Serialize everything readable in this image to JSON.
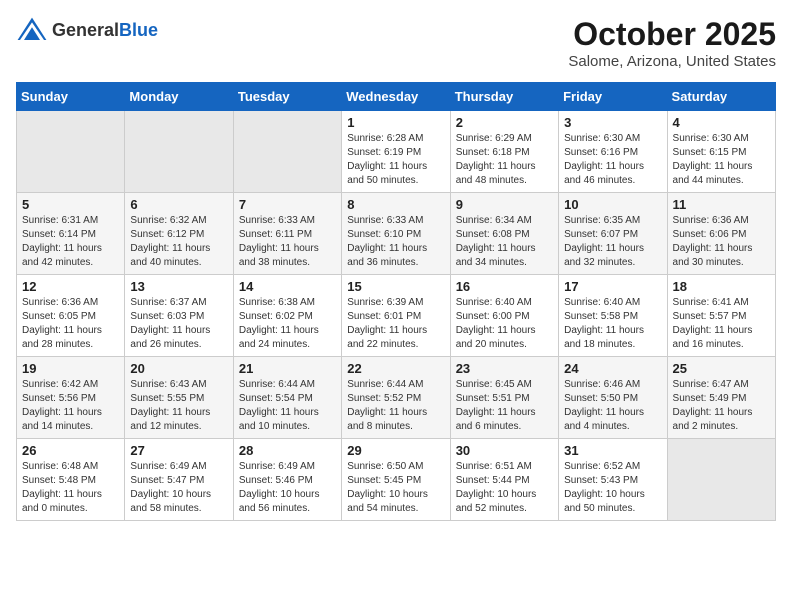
{
  "header": {
    "logo_general": "General",
    "logo_blue": "Blue",
    "month": "October 2025",
    "location": "Salome, Arizona, United States"
  },
  "weekdays": [
    "Sunday",
    "Monday",
    "Tuesday",
    "Wednesday",
    "Thursday",
    "Friday",
    "Saturday"
  ],
  "weeks": [
    [
      {
        "day": "",
        "empty": true
      },
      {
        "day": "",
        "empty": true
      },
      {
        "day": "",
        "empty": true
      },
      {
        "day": "1",
        "sunrise": "6:28 AM",
        "sunset": "6:19 PM",
        "daylight": "11 hours and 50 minutes."
      },
      {
        "day": "2",
        "sunrise": "6:29 AM",
        "sunset": "6:18 PM",
        "daylight": "11 hours and 48 minutes."
      },
      {
        "day": "3",
        "sunrise": "6:30 AM",
        "sunset": "6:16 PM",
        "daylight": "11 hours and 46 minutes."
      },
      {
        "day": "4",
        "sunrise": "6:30 AM",
        "sunset": "6:15 PM",
        "daylight": "11 hours and 44 minutes."
      }
    ],
    [
      {
        "day": "5",
        "sunrise": "6:31 AM",
        "sunset": "6:14 PM",
        "daylight": "11 hours and 42 minutes."
      },
      {
        "day": "6",
        "sunrise": "6:32 AM",
        "sunset": "6:12 PM",
        "daylight": "11 hours and 40 minutes."
      },
      {
        "day": "7",
        "sunrise": "6:33 AM",
        "sunset": "6:11 PM",
        "daylight": "11 hours and 38 minutes."
      },
      {
        "day": "8",
        "sunrise": "6:33 AM",
        "sunset": "6:10 PM",
        "daylight": "11 hours and 36 minutes."
      },
      {
        "day": "9",
        "sunrise": "6:34 AM",
        "sunset": "6:08 PM",
        "daylight": "11 hours and 34 minutes."
      },
      {
        "day": "10",
        "sunrise": "6:35 AM",
        "sunset": "6:07 PM",
        "daylight": "11 hours and 32 minutes."
      },
      {
        "day": "11",
        "sunrise": "6:36 AM",
        "sunset": "6:06 PM",
        "daylight": "11 hours and 30 minutes."
      }
    ],
    [
      {
        "day": "12",
        "sunrise": "6:36 AM",
        "sunset": "6:05 PM",
        "daylight": "11 hours and 28 minutes."
      },
      {
        "day": "13",
        "sunrise": "6:37 AM",
        "sunset": "6:03 PM",
        "daylight": "11 hours and 26 minutes."
      },
      {
        "day": "14",
        "sunrise": "6:38 AM",
        "sunset": "6:02 PM",
        "daylight": "11 hours and 24 minutes."
      },
      {
        "day": "15",
        "sunrise": "6:39 AM",
        "sunset": "6:01 PM",
        "daylight": "11 hours and 22 minutes."
      },
      {
        "day": "16",
        "sunrise": "6:40 AM",
        "sunset": "6:00 PM",
        "daylight": "11 hours and 20 minutes."
      },
      {
        "day": "17",
        "sunrise": "6:40 AM",
        "sunset": "5:58 PM",
        "daylight": "11 hours and 18 minutes."
      },
      {
        "day": "18",
        "sunrise": "6:41 AM",
        "sunset": "5:57 PM",
        "daylight": "11 hours and 16 minutes."
      }
    ],
    [
      {
        "day": "19",
        "sunrise": "6:42 AM",
        "sunset": "5:56 PM",
        "daylight": "11 hours and 14 minutes."
      },
      {
        "day": "20",
        "sunrise": "6:43 AM",
        "sunset": "5:55 PM",
        "daylight": "11 hours and 12 minutes."
      },
      {
        "day": "21",
        "sunrise": "6:44 AM",
        "sunset": "5:54 PM",
        "daylight": "11 hours and 10 minutes."
      },
      {
        "day": "22",
        "sunrise": "6:44 AM",
        "sunset": "5:52 PM",
        "daylight": "11 hours and 8 minutes."
      },
      {
        "day": "23",
        "sunrise": "6:45 AM",
        "sunset": "5:51 PM",
        "daylight": "11 hours and 6 minutes."
      },
      {
        "day": "24",
        "sunrise": "6:46 AM",
        "sunset": "5:50 PM",
        "daylight": "11 hours and 4 minutes."
      },
      {
        "day": "25",
        "sunrise": "6:47 AM",
        "sunset": "5:49 PM",
        "daylight": "11 hours and 2 minutes."
      }
    ],
    [
      {
        "day": "26",
        "sunrise": "6:48 AM",
        "sunset": "5:48 PM",
        "daylight": "11 hours and 0 minutes."
      },
      {
        "day": "27",
        "sunrise": "6:49 AM",
        "sunset": "5:47 PM",
        "daylight": "10 hours and 58 minutes."
      },
      {
        "day": "28",
        "sunrise": "6:49 AM",
        "sunset": "5:46 PM",
        "daylight": "10 hours and 56 minutes."
      },
      {
        "day": "29",
        "sunrise": "6:50 AM",
        "sunset": "5:45 PM",
        "daylight": "10 hours and 54 minutes."
      },
      {
        "day": "30",
        "sunrise": "6:51 AM",
        "sunset": "5:44 PM",
        "daylight": "10 hours and 52 minutes."
      },
      {
        "day": "31",
        "sunrise": "6:52 AM",
        "sunset": "5:43 PM",
        "daylight": "10 hours and 50 minutes."
      },
      {
        "day": "",
        "empty": true
      }
    ]
  ],
  "labels": {
    "sunrise": "Sunrise:",
    "sunset": "Sunset:",
    "daylight": "Daylight:"
  },
  "colors": {
    "header_bg": "#1565C0",
    "odd_row": "#ffffff",
    "even_row": "#f5f5f5",
    "empty_cell": "#e8e8e8"
  }
}
